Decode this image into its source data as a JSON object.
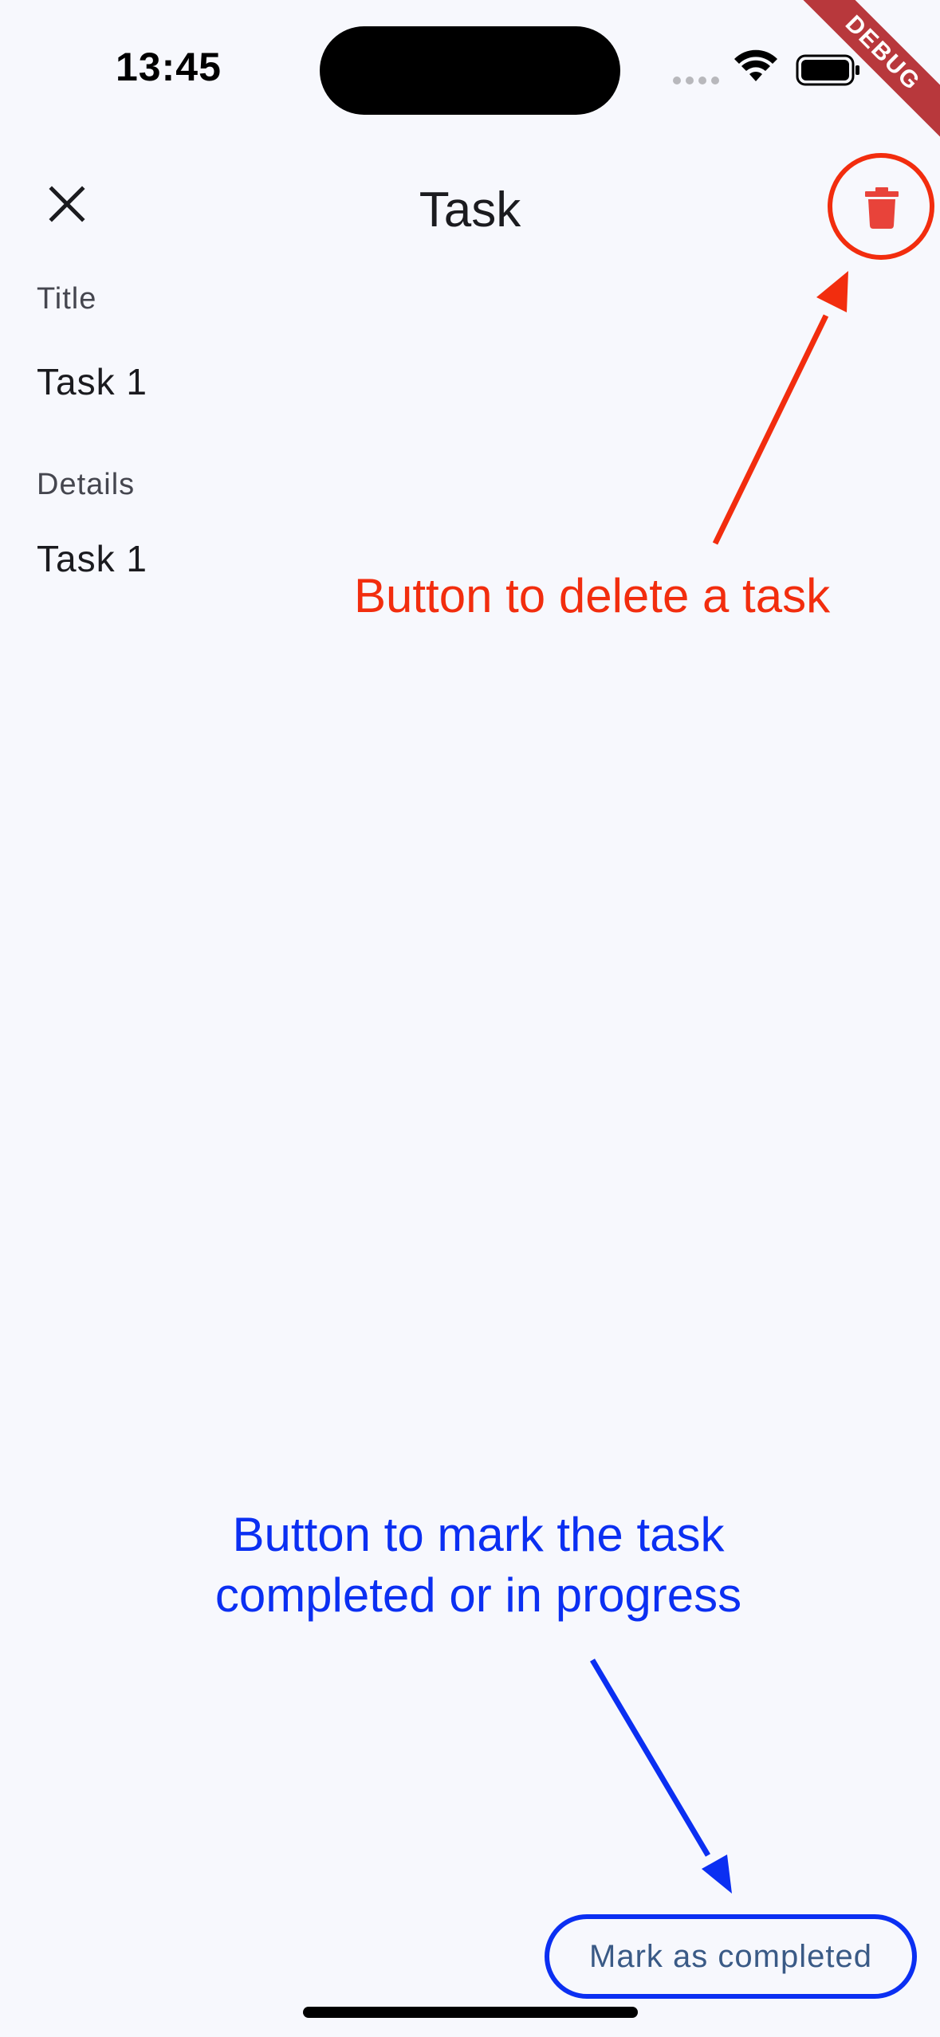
{
  "status_bar": {
    "time": "13:45"
  },
  "debug_banner": "DEBUG",
  "app_bar": {
    "title": "Task"
  },
  "fields": {
    "title_label": "Title",
    "title_value": "Task 1",
    "details_label": "Details",
    "details_value": "Task 1"
  },
  "annotations": {
    "delete_note": "Button to delete a task",
    "mark_note_line1": "Button to mark the task",
    "mark_note_line2": "completed or in progress"
  },
  "bottom": {
    "mark_button_label": "Mark as completed"
  },
  "colors": {
    "background": "#f7f8fd",
    "delete_icon": "#e8433a",
    "annotation_red": "#f22d0e",
    "annotation_blue": "#0b2ff2",
    "button_text": "#3a5a86"
  },
  "icons": {
    "close": "close-icon",
    "delete": "trash-icon",
    "wifi": "wifi-icon",
    "battery": "battery-icon"
  }
}
